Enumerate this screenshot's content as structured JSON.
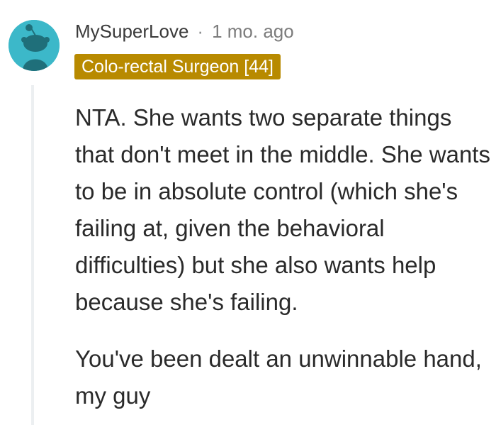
{
  "comment": {
    "author": {
      "username": "MySuperLove",
      "avatar_icon": "reddit-snoo-avatar-icon",
      "avatar_color": "#3cb8c9"
    },
    "separator": "·",
    "timestamp": "1 mo. ago",
    "flair": {
      "text": "Colo-rectal Surgeon [44]",
      "background": "#b88a00"
    },
    "body": {
      "paragraphs": [
        "NTA. She wants two separate things that don't meet in the middle. She wants to be in absolute control (which she's failing at, given the behavioral difficulties) but she also wants help because she's failing.",
        "You've been dealt an unwinnable hand, my guy"
      ]
    }
  }
}
